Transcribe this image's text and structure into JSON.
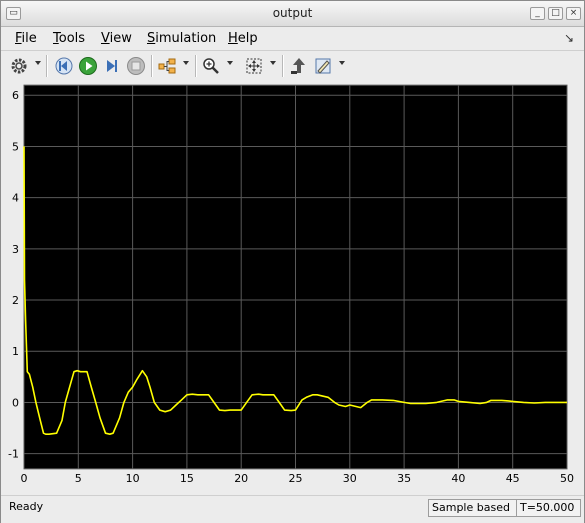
{
  "window": {
    "title": "output"
  },
  "menu": {
    "items": [
      {
        "label": "File",
        "accel": "F",
        "rest": "ile"
      },
      {
        "label": "Tools",
        "accel": "T",
        "rest": "ools"
      },
      {
        "label": "View",
        "accel": "V",
        "rest": "iew"
      },
      {
        "label": "Simulation",
        "accel": "S",
        "rest": "imulation"
      },
      {
        "label": "Help",
        "accel": "H",
        "rest": "elp"
      }
    ]
  },
  "toolbar": {
    "icons": [
      "gear-icon",
      "step-back-icon",
      "run-icon",
      "step-forward-icon",
      "stop-icon",
      "signal-hierarchy-icon",
      "zoom-icon",
      "fit-view-icon",
      "highlight-block-icon",
      "style-icon"
    ]
  },
  "status": {
    "ready": "Ready",
    "mode": "Sample based",
    "time": "T=50.000"
  },
  "colors": {
    "plot_background": "#000000",
    "grid": "#5a5a5a",
    "signal": "#ffff00",
    "axes_text": "#000000"
  },
  "chart_data": {
    "type": "line",
    "title": "",
    "xlabel": "",
    "ylabel": "",
    "xlim": [
      0,
      50
    ],
    "ylim": [
      -1.3,
      6.2
    ],
    "xticks": [
      0,
      5,
      10,
      15,
      20,
      25,
      30,
      35,
      40,
      45,
      50
    ],
    "yticks": [
      -1,
      0,
      1,
      2,
      3,
      4,
      5,
      6
    ],
    "grid": true,
    "series": [
      {
        "x": [
          0,
          0.05,
          0.15,
          0.3,
          0.5,
          0.8,
          1.1,
          1.5,
          1.8,
          2.0,
          2.3,
          3.0,
          3.5,
          3.8,
          4.2,
          4.6,
          4.9,
          5.2,
          5.8,
          6.2,
          6.6,
          7.0,
          7.5,
          7.9,
          8.2,
          8.8,
          9.2,
          9.6,
          10.0,
          10.4,
          10.9,
          11.3,
          11.6,
          12.0,
          12.5,
          13.0,
          13.5,
          14.0,
          14.5,
          15.0,
          15.5,
          16.0,
          17.0,
          17.5,
          18.0,
          18.5,
          19.0,
          20.0,
          20.5,
          21.0,
          21.6,
          22.0,
          23.0,
          23.5,
          24.0,
          24.6,
          25.0,
          25.6,
          26.0,
          26.6,
          27.0,
          28.0,
          28.6,
          29.0,
          29.6,
          30.0,
          31.0,
          31.6,
          32.0,
          32.6,
          33.0,
          34.0,
          35.0,
          35.6,
          36.0,
          37.0,
          38.0,
          39.0,
          39.6,
          40.0,
          41.0,
          42.0,
          42.6,
          43.0,
          44.0,
          44.6,
          45.0,
          46.0,
          47.0,
          48.0,
          49.0,
          50.0
        ],
        "y": [
          5.0,
          2.4,
          1.6,
          0.6,
          0.55,
          0.3,
          0.0,
          -0.35,
          -0.6,
          -0.62,
          -0.62,
          -0.6,
          -0.35,
          0.0,
          0.3,
          0.6,
          0.62,
          0.6,
          0.6,
          0.3,
          0.0,
          -0.3,
          -0.6,
          -0.62,
          -0.6,
          -0.3,
          0.0,
          0.2,
          0.3,
          0.45,
          0.62,
          0.5,
          0.3,
          0.0,
          -0.15,
          -0.18,
          -0.15,
          -0.05,
          0.05,
          0.15,
          0.16,
          0.15,
          0.15,
          0.0,
          -0.15,
          -0.16,
          -0.15,
          -0.15,
          0.0,
          0.15,
          0.16,
          0.15,
          0.15,
          0.0,
          -0.15,
          -0.16,
          -0.15,
          0.05,
          0.1,
          0.15,
          0.15,
          0.1,
          0.0,
          -0.05,
          -0.08,
          -0.05,
          -0.1,
          0.0,
          0.05,
          0.05,
          0.05,
          0.04,
          0.0,
          -0.02,
          -0.02,
          -0.02,
          0.0,
          0.05,
          0.05,
          0.02,
          0.0,
          -0.02,
          0.0,
          0.04,
          0.04,
          0.03,
          0.02,
          0.0,
          -0.01,
          0.0,
          0.0,
          0.0
        ]
      }
    ]
  }
}
